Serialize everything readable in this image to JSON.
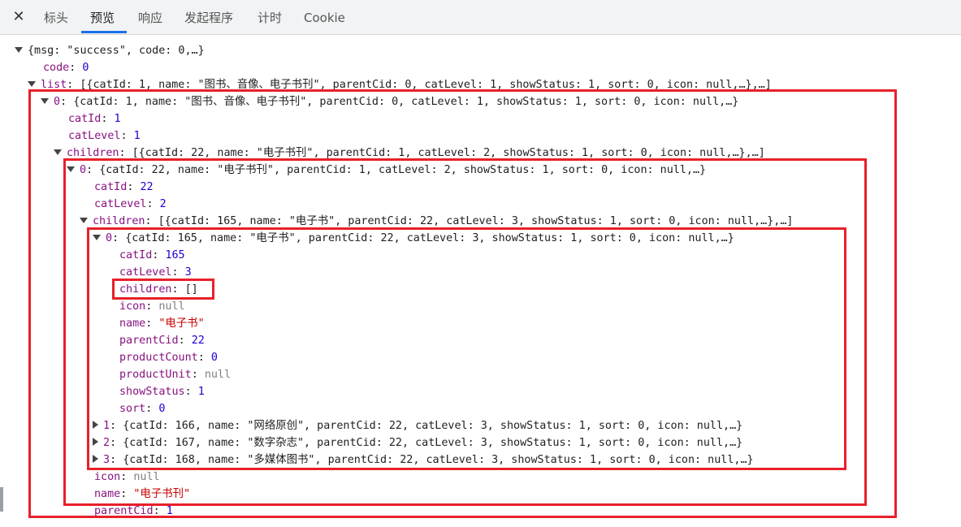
{
  "tabs": {
    "close_icon": "close-icon",
    "items": [
      "标头",
      "预览",
      "响应",
      "发起程序",
      "计时",
      "Cookie"
    ],
    "active_index": 1,
    "accent_color": "#1a73e8"
  },
  "tree": {
    "root_summary": "{msg: \"success\", code: 0,…}",
    "code_key": "code",
    "code_value": "0",
    "list_key": "list",
    "list_summary": "[{catId: 1, name: \"图书、音像、电子书刊\", parentCid: 0, catLevel: 1, showStatus: 1, sort: 0, icon: null,…},…]",
    "item0": {
      "index": "0",
      "summary": "{catId: 1, name: \"图书、音像、电子书刊\", parentCid: 0, catLevel: 1, showStatus: 1, sort: 0, icon: null,…}",
      "catId_key": "catId",
      "catId_value": "1",
      "catLevel_key": "catLevel",
      "catLevel_value": "1",
      "children_key": "children",
      "children_summary": "[{catId: 22, name: \"电子书刊\", parentCid: 1, catLevel: 2, showStatus: 1, sort: 0, icon: null,…},…]",
      "child0": {
        "index": "0",
        "summary": "{catId: 22, name: \"电子书刊\", parentCid: 1, catLevel: 2, showStatus: 1, sort: 0, icon: null,…}",
        "catId_key": "catId",
        "catId_value": "22",
        "catLevel_key": "catLevel",
        "catLevel_value": "2",
        "children_key": "children",
        "children_summary": "[{catId: 165, name: \"电子书\", parentCid: 22, catLevel: 3, showStatus: 1, sort: 0, icon: null,…},…]",
        "grandchild0": {
          "index": "0",
          "summary": "{catId: 165, name: \"电子书\", parentCid: 22, catLevel: 3, showStatus: 1, sort: 0, icon: null,…}",
          "fields": [
            {
              "key": "catId",
              "value": "165",
              "kind": "num"
            },
            {
              "key": "catLevel",
              "value": "3",
              "kind": "num"
            },
            {
              "key": "children",
              "value": "[]",
              "kind": "sum"
            },
            {
              "key": "icon",
              "value": "null",
              "kind": "nul"
            },
            {
              "key": "name",
              "value": "\"电子书\"",
              "kind": "str"
            },
            {
              "key": "parentCid",
              "value": "22",
              "kind": "num"
            },
            {
              "key": "productCount",
              "value": "0",
              "kind": "num"
            },
            {
              "key": "productUnit",
              "value": "null",
              "kind": "nul"
            },
            {
              "key": "showStatus",
              "value": "1",
              "kind": "num"
            },
            {
              "key": "sort",
              "value": "0",
              "kind": "num"
            }
          ]
        },
        "siblings": [
          {
            "index": "1",
            "summary": "{catId: 166, name: \"网络原创\", parentCid: 22, catLevel: 3, showStatus: 1, sort: 0, icon: null,…}"
          },
          {
            "index": "2",
            "summary": "{catId: 167, name: \"数字杂志\", parentCid: 22, catLevel: 3, showStatus: 1, sort: 0, icon: null,…}"
          },
          {
            "index": "3",
            "summary": "{catId: 168, name: \"多媒体图书\", parentCid: 22, catLevel: 3, showStatus: 1, sort: 0, icon: null,…}"
          }
        ],
        "icon_key": "icon",
        "icon_value": "null",
        "name_key": "name",
        "name_value": "\"电子书刊\"",
        "parentCid_key": "parentCid",
        "parentCid_value": "1"
      }
    }
  },
  "highlight_color": "#e8202a"
}
